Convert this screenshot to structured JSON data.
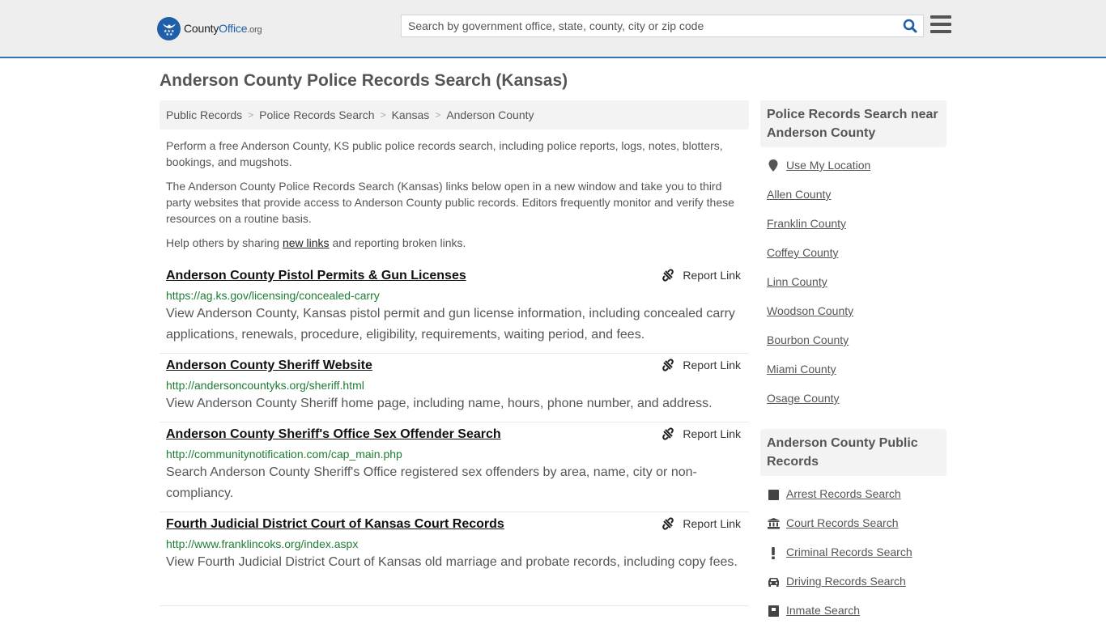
{
  "header": {
    "logo": {
      "part1": "County",
      "part2": "Office",
      "part3": ".org",
      "icon": "eagle-stars-badge-icon"
    },
    "search": {
      "placeholder": "Search by government office, state, county, city or zip code",
      "value": "",
      "icon": "search-icon"
    },
    "menu_icon": "hamburger-menu-icon",
    "colors": {
      "brand": "#1f5ea8",
      "header_bg": "#eeeeee",
      "accent_border": "#2f73b8"
    }
  },
  "page": {
    "title": "Anderson County Police Records Search (Kansas)",
    "breadcrumb": [
      "Public Records",
      "Police Records Search",
      "Kansas",
      "Anderson County"
    ],
    "breadcrumb_separator": ">",
    "intro": {
      "p1": "Perform a free Anderson County, KS public police records search, including police reports, logs, notes, blotters, bookings, and mugshots.",
      "p2": "The Anderson County Police Records Search (Kansas) links below open in a new window and take you to third party websites that provide access to Anderson County public records. Editors frequently monitor and verify these resources on a routine basis.",
      "p3_before": "Help others by sharing ",
      "p3_link": "new links",
      "p3_after": " and reporting broken links."
    }
  },
  "results": [
    {
      "title": "Anderson County Pistol Permits & Gun Licenses",
      "url": "https://ag.ks.gov/licensing/concealed-carry",
      "description": "View Anderson County, Kansas pistol permit and gun license information, including concealed carry applications, renewals, procedure, eligibility, requirements, waiting period, and fees.",
      "report_label": "Report Link"
    },
    {
      "title": "Anderson County Sheriff Website",
      "url": "http://andersoncountyks.org/sheriff.html",
      "description": "View Anderson County Sheriff home page, including name, hours, phone number, and address.",
      "report_label": "Report Link"
    },
    {
      "title": "Anderson County Sheriff's Office Sex Offender Search",
      "url": "http://communitynotification.com/cap_main.php",
      "description": "Search Anderson County Sheriff's Office registered sex offenders by area, name, city or non-compliancy.",
      "report_label": "Report Link"
    },
    {
      "title": "Fourth Judicial District Court of Kansas Court Records",
      "url": "http://www.franklincoks.org/index.aspx",
      "description": "View Fourth Judicial District Court of Kansas old marriage and probate records, including copy fees.",
      "report_label": "Report Link"
    }
  ],
  "sidebar": {
    "nearby": {
      "heading": "Police Records Search near Anderson County",
      "use_location": "Use My Location",
      "counties": [
        "Allen County",
        "Franklin County",
        "Coffey County",
        "Linn County",
        "Woodson County",
        "Bourbon County",
        "Miami County",
        "Osage County"
      ]
    },
    "public_records": {
      "heading": "Anderson County Public Records",
      "items": [
        {
          "label": "Arrest Records Search",
          "icon": "square-icon"
        },
        {
          "label": "Court Records Search",
          "icon": "courthouse-icon"
        },
        {
          "label": "Criminal Records Search",
          "icon": "exclamation-icon"
        },
        {
          "label": "Driving Records Search",
          "icon": "car-icon"
        },
        {
          "label": "Inmate Search",
          "icon": "jail-icon"
        }
      ]
    }
  }
}
